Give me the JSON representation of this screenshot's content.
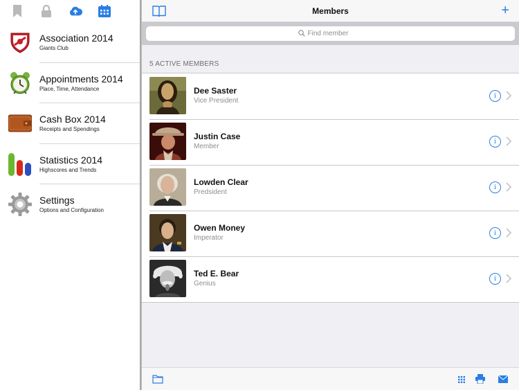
{
  "sidebar": {
    "toolbar_icons": [
      "bookmark-icon",
      "lock-icon",
      "cloud-upload-icon",
      "calendar-icon"
    ],
    "items": [
      {
        "title": "Association 2014",
        "subtitle": "Giants Club",
        "icon": "club-crest-icon"
      },
      {
        "title": "Appointments 2014",
        "subtitle": "Place, Time, Attendance",
        "icon": "alarm-clock-icon"
      },
      {
        "title": "Cash Box 2014",
        "subtitle": "Receipts and Spendings",
        "icon": "wallet-icon"
      },
      {
        "title": "Statistics 2014",
        "subtitle": "Highscores and Trends",
        "icon": "bar-chart-icon"
      },
      {
        "title": "Settings",
        "subtitle": "Options and Configuration",
        "icon": "gear-icon"
      }
    ]
  },
  "navbar": {
    "title": "Members",
    "add_label": "+"
  },
  "search": {
    "placeholder": "Find member"
  },
  "section": {
    "header": "5 ACTIVE MEMBERS"
  },
  "members": [
    {
      "name": "Dee Saster",
      "role": "Vice President"
    },
    {
      "name": "Justin Case",
      "role": "Member"
    },
    {
      "name": "Lowden Clear",
      "role": "Predsident"
    },
    {
      "name": "Owen Money",
      "role": "Imperator"
    },
    {
      "name": "Ted E. Bear",
      "role": "Genius"
    }
  ],
  "info_glyph": "i",
  "bottom_bar_icons": [
    "folder-icon",
    "grid-icon",
    "print-icon",
    "mail-icon"
  ],
  "colors": {
    "accent": "#2a7ee3",
    "sidebar_icon_gray": "#b9b9b9"
  }
}
